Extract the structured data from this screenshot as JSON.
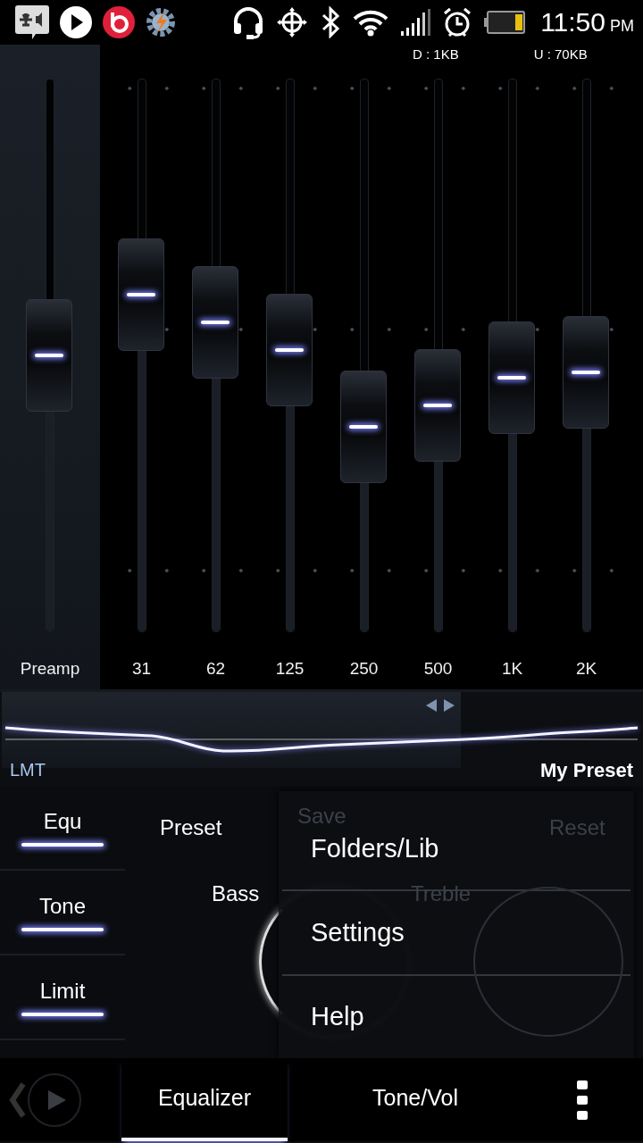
{
  "status_bar": {
    "time": "11:50",
    "ampm": "PM",
    "download": "D : 1KB",
    "upload": "U : 70KB"
  },
  "equalizer": {
    "preamp": {
      "label": "Preamp",
      "level": 0.5
    },
    "bands": [
      {
        "label": "31",
        "level": 0.61
      },
      {
        "label": "62",
        "level": 0.56
      },
      {
        "label": "125",
        "level": 0.51
      },
      {
        "label": "250",
        "level": 0.37
      },
      {
        "label": "500",
        "level": 0.41
      },
      {
        "label": "1K",
        "level": 0.46
      },
      {
        "label": "2K",
        "level": 0.47
      }
    ]
  },
  "curve_panel": {
    "limiter": "LMT",
    "preset_name": "My Preset"
  },
  "side_tabs": [
    {
      "label": "Equ",
      "on": true
    },
    {
      "label": "Tone",
      "on": true
    },
    {
      "label": "Limit",
      "on": true
    }
  ],
  "controls": {
    "preset": "Preset",
    "save": "Save",
    "reset": "Reset",
    "bass": "Bass",
    "treble": "Treble"
  },
  "menu": {
    "items": [
      "Folders/Lib",
      "Settings",
      "Help"
    ]
  },
  "bottom_tabs": [
    {
      "label": "Equalizer",
      "selected": true
    },
    {
      "label": "Tone/Vol",
      "selected": false
    }
  ]
}
